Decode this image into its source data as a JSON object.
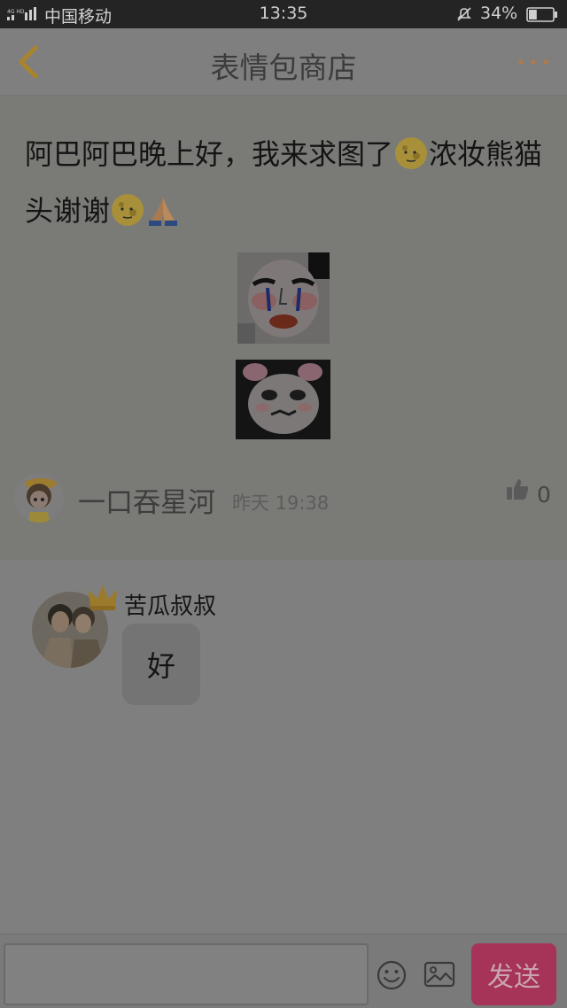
{
  "status_bar": {
    "carrier": "中国移动",
    "time": "13:35",
    "battery": "34%",
    "battery_level": 0.34
  },
  "header": {
    "title": "表情包商店",
    "back_icon": "chevron-left-icon",
    "more_icon": "more-dots-icon"
  },
  "post": {
    "text_part1": "阿巴阿巴晚上好，我来求图了",
    "text_part2": "浓妆熊猫头谢谢",
    "emojis": [
      "moon-face-emoji",
      "moon-face-emoji",
      "praying-hands-emoji"
    ],
    "author": {
      "name": "一口吞星河",
      "date": "昨天 19:38",
      "likes": "0"
    }
  },
  "reply": {
    "username": "苦瓜叔叔",
    "message": "好"
  },
  "input_bar": {
    "placeholder": "",
    "send_label": "发送"
  },
  "colors": {
    "accent": "#e8b04a",
    "send_button": "#a63358",
    "more_dots": "#c8885a"
  }
}
